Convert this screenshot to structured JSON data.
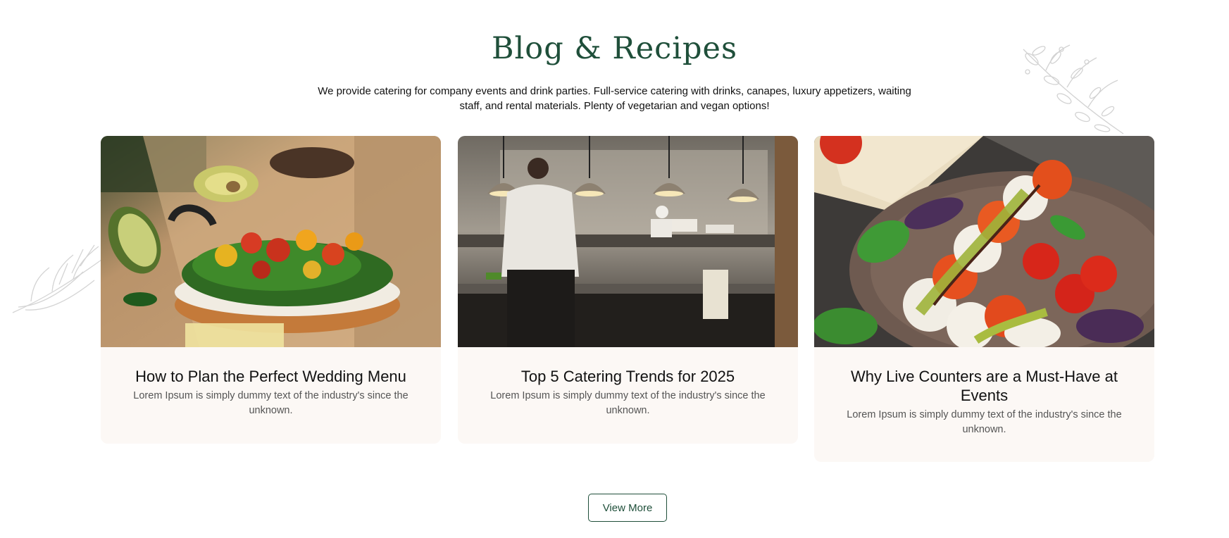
{
  "section": {
    "title": "Blog & Recipes",
    "description": "We provide catering for company events and drink parties. Full-service catering with drinks, canapes, luxury appetizers, waiting staff, and rental materials. Plenty of vegetarian and vegan options!"
  },
  "posts": [
    {
      "title": "How to Plan the Perfect Wedding Menu",
      "excerpt": "Lorem Ipsum is simply dummy text of the industry's since the unknown.",
      "image_icon": "sandwich-photo"
    },
    {
      "title": "Top 5 Catering Trends for 2025",
      "excerpt": "Lorem Ipsum is simply dummy text of the industry's since the unknown.",
      "image_icon": "kitchen-chef-photo"
    },
    {
      "title": "Why Live Counters are a Must-Have at Events",
      "excerpt": "Lorem Ipsum is simply dummy text of the industry's since the unknown.",
      "image_icon": "caprese-salad-photo"
    }
  ],
  "actions": {
    "view_more_label": "View More"
  },
  "colors": {
    "accent": "#1f4f3a",
    "card_background": "#fcf8f5",
    "text": "#111111",
    "muted_text": "#555555"
  }
}
